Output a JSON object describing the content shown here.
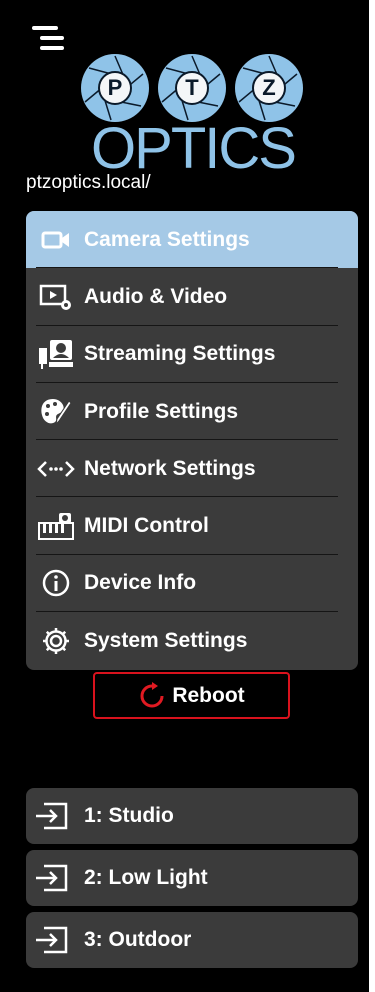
{
  "header": {
    "menu_icon": "hamburger-icon"
  },
  "logo": {
    "letters": [
      "P",
      "T",
      "Z"
    ],
    "wordmark": "OPTICS",
    "brand_color": "#8fc3e8"
  },
  "host": "ptzoptics.local/",
  "menu": {
    "items": [
      {
        "label": "Camera Settings",
        "icon": "camera-icon",
        "active": true
      },
      {
        "label": "Audio & Video",
        "icon": "audio-video-icon"
      },
      {
        "label": "Streaming Settings",
        "icon": "streaming-icon"
      },
      {
        "label": "Profile Settings",
        "icon": "palette-icon"
      },
      {
        "label": "Network Settings",
        "icon": "network-icon"
      },
      {
        "label": "MIDI Control",
        "icon": "midi-icon"
      },
      {
        "label": "Device Info",
        "icon": "info-icon"
      },
      {
        "label": "System Settings",
        "icon": "gear-icon"
      }
    ],
    "active_color": "#a5c9e6"
  },
  "reboot": {
    "label": "Reboot",
    "icon": "refresh-icon",
    "accent": "#d9121d"
  },
  "presets": [
    {
      "label": "1: Studio",
      "icon": "input-icon"
    },
    {
      "label": "2: Low Light",
      "icon": "input-icon"
    },
    {
      "label": "3: Outdoor",
      "icon": "input-icon"
    }
  ]
}
